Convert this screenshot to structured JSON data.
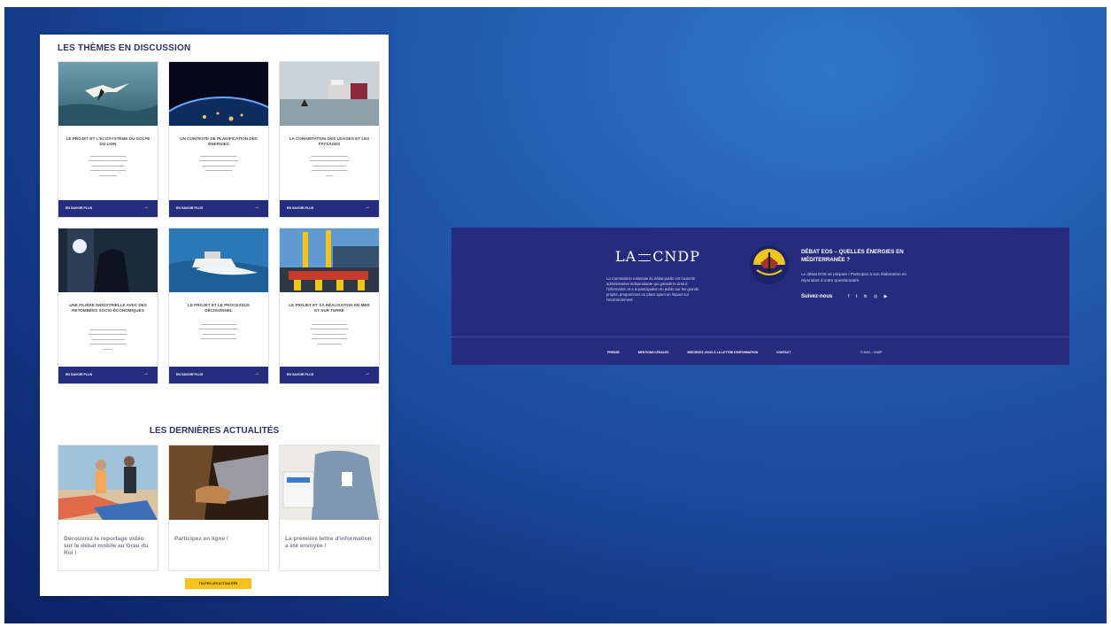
{
  "themes": {
    "title": "LES THÈMES EN DISCUSSION",
    "button_label": "EN SAVOIR PLUS",
    "arrow": "→",
    "cards": [
      {
        "title": "LE PROJET ET L'ÉCOSYSTÈME DU GOLFE DU LION",
        "icon": "gannet-sea-image"
      },
      {
        "title": "UN CONTEXTE DE PLANIFICATION DES ÉNERGIES",
        "icon": "earth-night-image"
      },
      {
        "title": "LA COHABITATION DES USAGES ET LES PAYSAGES",
        "icon": "ship-sea-image"
      },
      {
        "title": "UNE FILIÈRE INDUSTRIELLE AVEC DES RETOMBÉES SOCIO-ÉCONOMIQUES",
        "icon": "welder-image"
      },
      {
        "title": "LE PROJET ET LE PROCESSUS DÉCISIONNEL",
        "icon": "boat-image"
      },
      {
        "title": "LE PROJET ET SA RÉALISATION EN MER ET SUR TERRE",
        "icon": "port-construction-image"
      }
    ]
  },
  "news": {
    "title": "LES DERNIÈRES ACTUALITÉS",
    "items": [
      {
        "date": "",
        "headline": "Découvrez le reportage vidéo sur le débat mobile au Grau du Roi !"
      },
      {
        "date": "",
        "headline": "Participez en ligne !"
      },
      {
        "date": "",
        "headline": "La première lettre d'information a été envoyée !"
      }
    ],
    "all_button": "TOUTES LES ACTUALITÉS"
  },
  "footer": {
    "logo_left": "LA",
    "logo_right": "CNDP",
    "description": "La Commission nationale du débat public est l'autorité administrative indépendante qui garantit le droit à l'information et à la participation du public sur les grands projets, programmes ou plans ayant un impact sur l'environnement.",
    "debate_title": "DÉBAT EOS – QUELLES ÉNERGIES EN MÉDITERRANÉE ?",
    "debate_text": "Le débat EOS se prépare ! Participez à son élaboration en répondant à notre questionnaire.",
    "follow": "Suivez-nous",
    "social": [
      "f",
      "t",
      "in",
      "◎",
      "▶"
    ],
    "links": [
      "PRESSE",
      "MENTIONS LÉGALES",
      "INSCRIVEZ-VOUS À LA LETTRE D'INFORMATION",
      "CONTACT"
    ],
    "copyright": "© 2021 – CNDP"
  },
  "colors": {
    "navy": "#272b7e",
    "yellow": "#f6c21b",
    "heading": "#2b3466"
  }
}
